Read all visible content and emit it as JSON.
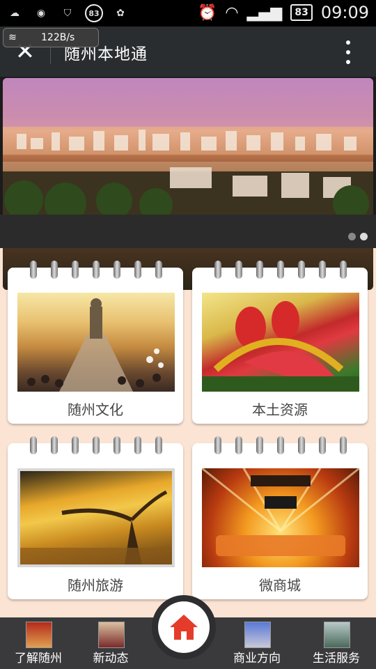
{
  "status_bar": {
    "battery_badge": "83",
    "battery_level": "83",
    "time": "09:09"
  },
  "header": {
    "net_speed": "122B/s",
    "title": "随州本地通",
    "close_icon": "close-icon",
    "more_icon": "more-vert-icon"
  },
  "banner": {
    "slide_count": 2,
    "active_index": 1
  },
  "cards": [
    {
      "label": "随州文化"
    },
    {
      "label": "本土资源"
    },
    {
      "label": "随州旅游"
    },
    {
      "label": "微商城"
    }
  ],
  "bottom_nav": [
    {
      "label": "了解随州"
    },
    {
      "label": "新动态"
    },
    {
      "label": "商业方向"
    },
    {
      "label": "生活服务"
    }
  ],
  "colors": {
    "accent": "#e53b2a",
    "header_bg": "#2a2d30",
    "page_bg": "#fbe4d4",
    "nav_bg": "#3a3a3c"
  }
}
